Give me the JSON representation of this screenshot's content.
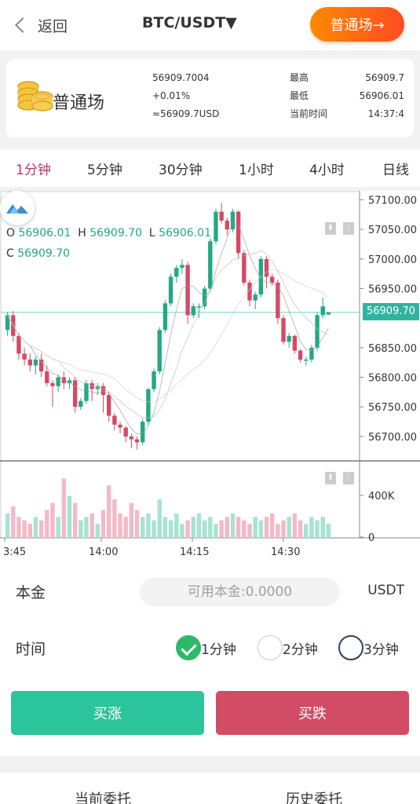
{
  "header": {
    "back_label": "返回",
    "pair": "BTC/USDT▼",
    "mode_button": "普通场→"
  },
  "info": {
    "name": "普通场",
    "price": "56909.7004",
    "change": "+0.01%",
    "usd": "≈56909.7USD",
    "high_label": "最高",
    "high": "56909.7",
    "low_label": "最低",
    "low": "56906.01",
    "time_label": "当前时间",
    "time": "14:37:4"
  },
  "intervals": [
    "1分钟",
    "5分钟",
    "30分钟",
    "1小时",
    "4小时",
    "日线"
  ],
  "active_interval": 0,
  "chart_data": {
    "type": "candlestick",
    "ohlc_labels": {
      "o": "O",
      "h": "H",
      "l": "L",
      "c": "C",
      "o_val": "56906.01",
      "h_val": "56909.70",
      "l_val": "56906.01",
      "c_val": "56909.70"
    },
    "price_ticks": [
      "57100.00",
      "57050.00",
      "57000.00",
      "56950.00",
      "56909.70",
      "56850.00",
      "56800.00",
      "56750.00",
      "56700.00"
    ],
    "ylim": [
      56660,
      57110
    ],
    "last_price": 56909.7,
    "volume_ticks": [
      "400K",
      "0"
    ],
    "time_ticks": [
      "3:45",
      "14:00",
      "14:15",
      "14:30"
    ],
    "candles": [
      [
        56880,
        56905,
        56870,
        56910
      ],
      [
        56905,
        56870,
        56860,
        56912
      ],
      [
        56870,
        56840,
        56830,
        56875
      ],
      [
        56840,
        56830,
        56820,
        56850
      ],
      [
        56830,
        56820,
        56810,
        56840
      ],
      [
        56820,
        56830,
        56805,
        56835
      ],
      [
        56830,
        56810,
        56800,
        56840
      ],
      [
        56810,
        56790,
        56785,
        56820
      ],
      [
        56790,
        56785,
        56750,
        56795
      ],
      [
        56785,
        56800,
        56775,
        56805
      ],
      [
        56800,
        56790,
        56780,
        56810
      ],
      [
        56790,
        56795,
        56780,
        56800
      ],
      [
        56795,
        56750,
        56740,
        56800
      ],
      [
        56750,
        56760,
        56745,
        56765
      ],
      [
        56760,
        56790,
        56755,
        56795
      ],
      [
        56790,
        56780,
        56760,
        56795
      ],
      [
        56780,
        56785,
        56770,
        56790
      ],
      [
        56785,
        56770,
        56740,
        56790
      ],
      [
        56770,
        56735,
        56725,
        56775
      ],
      [
        56735,
        56720,
        56710,
        56740
      ],
      [
        56720,
        56715,
        56705,
        56725
      ],
      [
        56715,
        56700,
        56690,
        56718
      ],
      [
        56700,
        56695,
        56680,
        56705
      ],
      [
        56695,
        56690,
        56678,
        56700
      ],
      [
        56690,
        56725,
        56685,
        56730
      ],
      [
        56725,
        56780,
        56720,
        56782
      ],
      [
        56780,
        56810,
        56775,
        56815
      ],
      [
        56810,
        56880,
        56805,
        56885
      ],
      [
        56880,
        56925,
        56875,
        56930
      ],
      [
        56925,
        56970,
        56920,
        56975
      ],
      [
        56970,
        56985,
        56960,
        56990
      ],
      [
        56985,
        56990,
        56975,
        57000
      ],
      [
        56990,
        56905,
        56890,
        56995
      ],
      [
        56905,
        56920,
        56900,
        56925
      ],
      [
        56920,
        56920,
        56900,
        56925
      ],
      [
        56920,
        56950,
        56915,
        56955
      ],
      [
        56950,
        57030,
        56945,
        57035
      ],
      [
        57030,
        57080,
        57025,
        57085
      ],
      [
        57080,
        57065,
        57060,
        57095
      ],
      [
        57065,
        57050,
        57040,
        57070
      ],
      [
        57050,
        57080,
        57045,
        57085
      ],
      [
        57080,
        57010,
        57000,
        57082
      ],
      [
        57010,
        56960,
        56955,
        57015
      ],
      [
        56960,
        56930,
        56920,
        56965
      ],
      [
        56930,
        56940,
        56915,
        56945
      ],
      [
        56940,
        57000,
        56935,
        57005
      ],
      [
        57000,
        56970,
        56950,
        57005
      ],
      [
        56970,
        56960,
        56955,
        56975
      ],
      [
        56960,
        56900,
        56890,
        56965
      ],
      [
        56900,
        56860,
        56855,
        56905
      ],
      [
        56860,
        56870,
        56850,
        56875
      ],
      [
        56870,
        56845,
        56840,
        56872
      ],
      [
        56845,
        56830,
        56825,
        56848
      ],
      [
        56830,
        56830,
        56820,
        56835
      ],
      [
        56830,
        56850,
        56825,
        56855
      ],
      [
        56850,
        56905,
        56845,
        56910
      ],
      [
        56905,
        56920,
        56900,
        56935
      ],
      [
        56906,
        56910,
        56906,
        56910
      ]
    ],
    "volumes": [
      0.35,
      0.45,
      0.3,
      0.25,
      0.2,
      0.3,
      0.25,
      0.4,
      0.5,
      0.3,
      0.85,
      0.6,
      0.5,
      0.25,
      0.3,
      0.35,
      0.2,
      0.4,
      0.75,
      0.55,
      0.35,
      0.3,
      0.5,
      0.4,
      0.3,
      0.35,
      0.25,
      0.55,
      0.3,
      0.25,
      0.35,
      0.2,
      0.25,
      0.3,
      0.35,
      0.25,
      0.3,
      0.2,
      0.25,
      0.3,
      0.35,
      0.3,
      0.25,
      0.2,
      0.3,
      0.25,
      0.3,
      0.35,
      0.2,
      0.25,
      0.3,
      0.35,
      0.25,
      0.2,
      0.3,
      0.25,
      0.3,
      0.2
    ],
    "colors": {
      "up": "#22a884",
      "down": "#d44a66",
      "up_vol": "#a6e3d2",
      "down_vol": "#f3b9c7",
      "last_line": "#6fd3c4"
    }
  },
  "form": {
    "principal_label": "本金",
    "amount_placeholder": "可用本金:0.0000",
    "unit": "USDT",
    "time_label": "时间",
    "options": [
      "1分钟",
      "2分钟",
      "3分钟"
    ],
    "buy_up": "买涨",
    "buy_down": "买跌"
  },
  "orders": {
    "current": "当前委托",
    "history": "历史委托"
  }
}
